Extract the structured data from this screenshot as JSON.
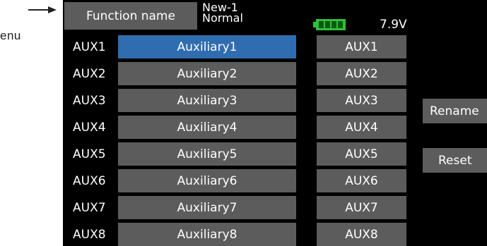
{
  "caption": "enu",
  "header": {
    "function_name_label": "Function name",
    "model_name": "New-1",
    "condition": "Normal",
    "voltage": "7.9V"
  },
  "rows": [
    {
      "channel": "AUX1",
      "name": "Auxiliary1",
      "alias": "AUX1"
    },
    {
      "channel": "AUX2",
      "name": "Auxiliary2",
      "alias": "AUX2"
    },
    {
      "channel": "AUX3",
      "name": "Auxiliary3",
      "alias": "AUX3"
    },
    {
      "channel": "AUX4",
      "name": "Auxiliary4",
      "alias": "AUX4"
    },
    {
      "channel": "AUX5",
      "name": "Auxiliary5",
      "alias": "AUX5"
    },
    {
      "channel": "AUX6",
      "name": "Auxiliary6",
      "alias": "AUX6"
    },
    {
      "channel": "AUX7",
      "name": "Auxiliary7",
      "alias": "AUX7"
    },
    {
      "channel": "AUX8",
      "name": "Auxiliary8",
      "alias": "AUX8"
    }
  ],
  "buttons": {
    "rename": "Rename",
    "reset": "Reset"
  },
  "colors": {
    "screen_bg": "#000000",
    "cell": "#5c5c5c",
    "selected": "#2f6db0",
    "battery": "#2fbf3a"
  }
}
